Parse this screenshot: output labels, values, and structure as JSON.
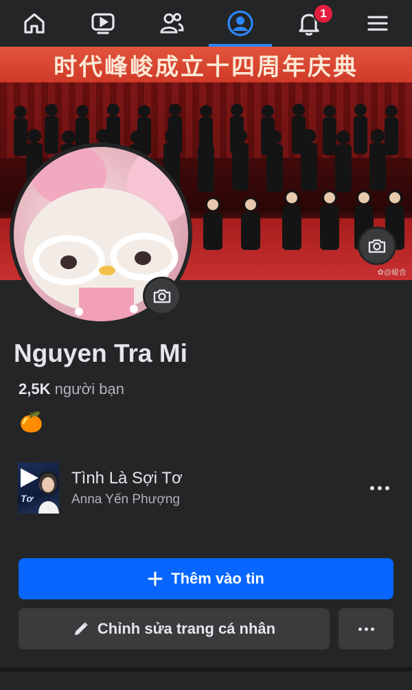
{
  "nav": {
    "items": [
      "home-icon",
      "video-icon",
      "friends-icon",
      "profile-icon",
      "notifications-icon",
      "menu-icon"
    ],
    "active": "profile-icon",
    "notification_count": "1",
    "accent": "#2d88ff",
    "badge_color": "#e41e3f"
  },
  "cover": {
    "banner_text": "时代峰峻成立十四周年庆典",
    "watermark": "✿@峻合"
  },
  "profile": {
    "name": "Nguyen Tra Mi",
    "friends_count": "2,5K",
    "friends_label": " người bạn",
    "emoji": "🍊"
  },
  "music": {
    "title": "Tình Là Sợi Tơ",
    "artist": "Anna Yến Phượng",
    "thumb_text": "Tơ"
  },
  "actions": {
    "add_story": "Thêm vào tin",
    "edit_profile": "Chỉnh sửa trang cá nhân",
    "primary_color": "#0866ff"
  }
}
